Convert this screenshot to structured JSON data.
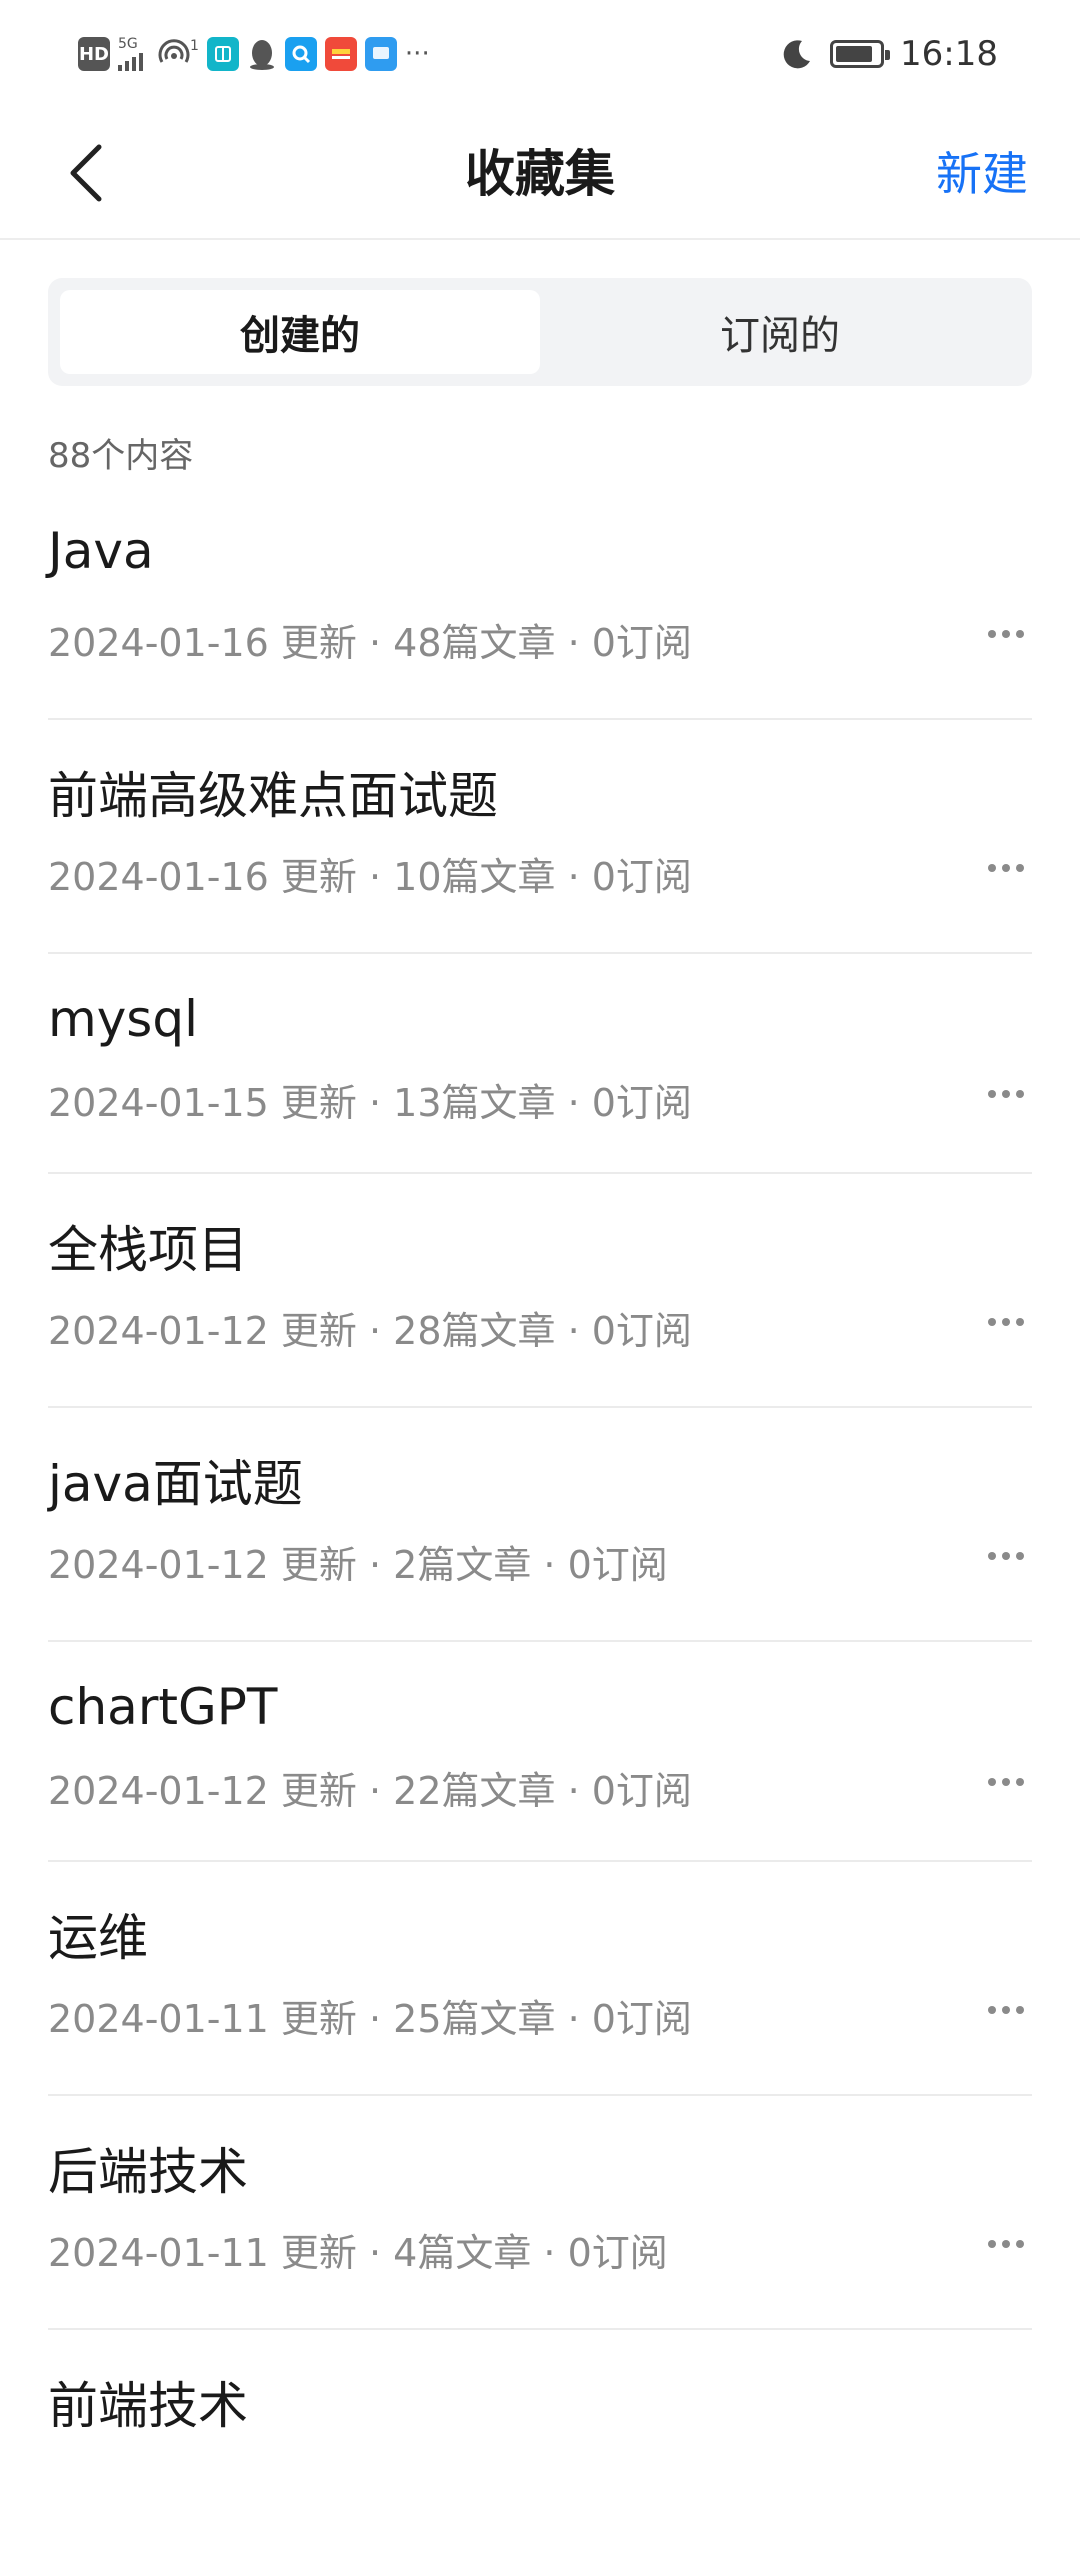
{
  "status_bar": {
    "network": "HD",
    "signal": "5G",
    "hotspot_count": "1",
    "more": "···",
    "time": "16:18",
    "battery_level": 0.85
  },
  "header": {
    "title": "收藏集",
    "back_icon": "chevron-left-icon",
    "new_label": "新建"
  },
  "tabs": [
    {
      "label": "创建的",
      "active": true
    },
    {
      "label": "订阅的",
      "active": false
    }
  ],
  "count_text": "88个内容",
  "items": [
    {
      "title": "Java",
      "meta": "2024-01-16 更新 · 48篇文章 · 0订阅"
    },
    {
      "title": "前端高级难点面试题",
      "meta": "2024-01-16 更新 · 10篇文章 · 0订阅"
    },
    {
      "title": "mysql",
      "meta": "2024-01-15 更新 · 13篇文章 · 0订阅"
    },
    {
      "title": "全栈项目",
      "meta": "2024-01-12 更新 · 28篇文章 · 0订阅"
    },
    {
      "title": "java面试题",
      "meta": "2024-01-12 更新 · 2篇文章 · 0订阅"
    },
    {
      "title": "chartGPT",
      "meta": "2024-01-12 更新 · 22篇文章 · 0订阅"
    },
    {
      "title": "运维",
      "meta": "2024-01-11 更新 · 25篇文章 · 0订阅"
    },
    {
      "title": "后端技术",
      "meta": "2024-01-11 更新 · 4篇文章 · 0订阅"
    },
    {
      "title": "前端技术",
      "meta": ""
    }
  ],
  "colors": {
    "accent": "#1772f6",
    "text_primary": "#1a1a1a",
    "text_secondary": "#8a8a8a",
    "segment_bg": "#f2f3f5"
  }
}
